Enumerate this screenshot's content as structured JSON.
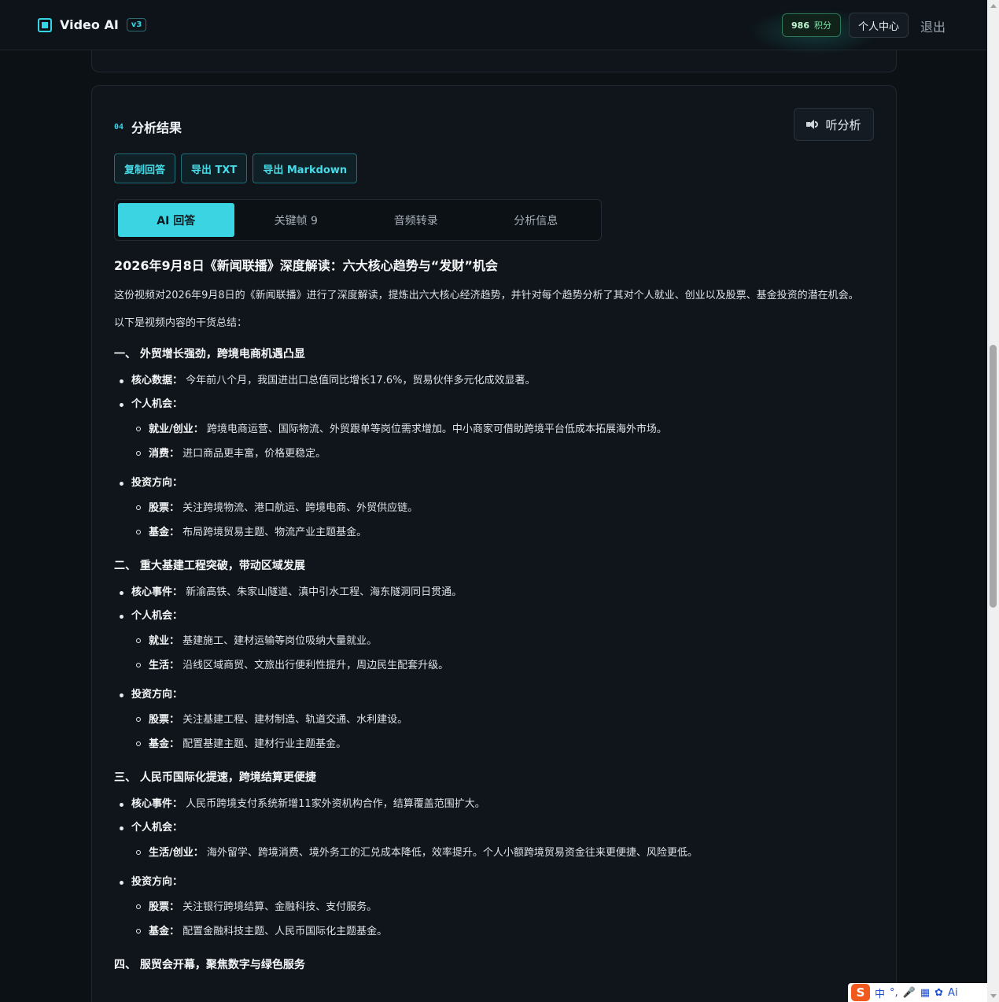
{
  "header": {
    "app_title": "Video AI",
    "version_badge": "v3",
    "points_value": "986",
    "points_unit": "积分",
    "user_center_label": "个人中心",
    "logout_label": "退出"
  },
  "section": {
    "number": "04",
    "title": "分析结果",
    "listen_label": "听分析"
  },
  "actions": {
    "copy_label": "复制回答",
    "export_txt_label": "导出 TXT",
    "export_md_label": "导出 Markdown"
  },
  "tabs": [
    {
      "label": "AI 回答",
      "active": true
    },
    {
      "label": "关键帧 9",
      "active": false
    },
    {
      "label": "音频转录",
      "active": false
    },
    {
      "label": "分析信息",
      "active": false
    }
  ],
  "answer": {
    "title": "2026年9月8日《新闻联播》深度解读：六大核心趋势与“发财”机会",
    "intro": "这份视频对2026年9月8日的《新闻联播》进行了深度解读，提炼出六大核心经济趋势，并针对每个趋势分析了其对个人就业、创业以及股票、基金投资的潜在机会。",
    "summary_lead": "以下是视频内容的干货总结：",
    "sections": [
      {
        "heading": "一、 外贸增长强劲，跨境电商机遇凸显",
        "core_label": "核心数据：",
        "core_text": "今年前八个月，我国进出口总值同比增长17.6%，贸易伙伴多元化成效显著。",
        "personal_label": "个人机会：",
        "personal_items": [
          {
            "label": "就业/创业：",
            "text": "跨境电商运营、国际物流、外贸跟单等岗位需求增加。中小商家可借助跨境平台低成本拓展海外市场。"
          },
          {
            "label": "消费：",
            "text": "进口商品更丰富，价格更稳定。"
          }
        ],
        "invest_label": "投资方向：",
        "invest_items": [
          {
            "label": "股票：",
            "text": "关注跨境物流、港口航运、跨境电商、外贸供应链。"
          },
          {
            "label": "基金：",
            "text": "布局跨境贸易主题、物流产业主题基金。"
          }
        ]
      },
      {
        "heading": "二、 重大基建工程突破，带动区域发展",
        "core_label": "核心事件：",
        "core_text": "新渝高铁、朱家山隧道、滇中引水工程、海东隧洞同日贯通。",
        "personal_label": "个人机会：",
        "personal_items": [
          {
            "label": "就业：",
            "text": "基建施工、建材运输等岗位吸纳大量就业。"
          },
          {
            "label": "生活：",
            "text": "沿线区域商贸、文旅出行便利性提升，周边民生配套升级。"
          }
        ],
        "invest_label": "投资方向：",
        "invest_items": [
          {
            "label": "股票：",
            "text": "关注基建工程、建材制造、轨道交通、水利建设。"
          },
          {
            "label": "基金：",
            "text": "配置基建主题、建材行业主题基金。"
          }
        ]
      },
      {
        "heading": "三、 人民币国际化提速，跨境结算更便捷",
        "core_label": "核心事件：",
        "core_text": "人民币跨境支付系统新增11家外资机构合作，结算覆盖范围扩大。",
        "personal_label": "个人机会：",
        "personal_items": [
          {
            "label": "生活/创业：",
            "text": "海外留学、跨境消费、境外务工的汇兑成本降低，效率提升。个人小额跨境贸易资金往来更便捷、风险更低。"
          }
        ],
        "invest_label": "投资方向：",
        "invest_items": [
          {
            "label": "股票：",
            "text": "关注银行跨境结算、金融科技、支付服务。"
          },
          {
            "label": "基金：",
            "text": "配置金融科技主题、人民币国际化主题基金。"
          }
        ]
      }
    ],
    "next_heading": "四、 服贸会开幕，聚焦数字与绿色服务"
  },
  "ime": {
    "logo": "S",
    "lang": "中",
    "punct": "°,",
    "ai": "Ai"
  },
  "colors": {
    "accent": "#3ad4e3",
    "background": "#0c1116",
    "points_green": "#7fe0a8"
  }
}
